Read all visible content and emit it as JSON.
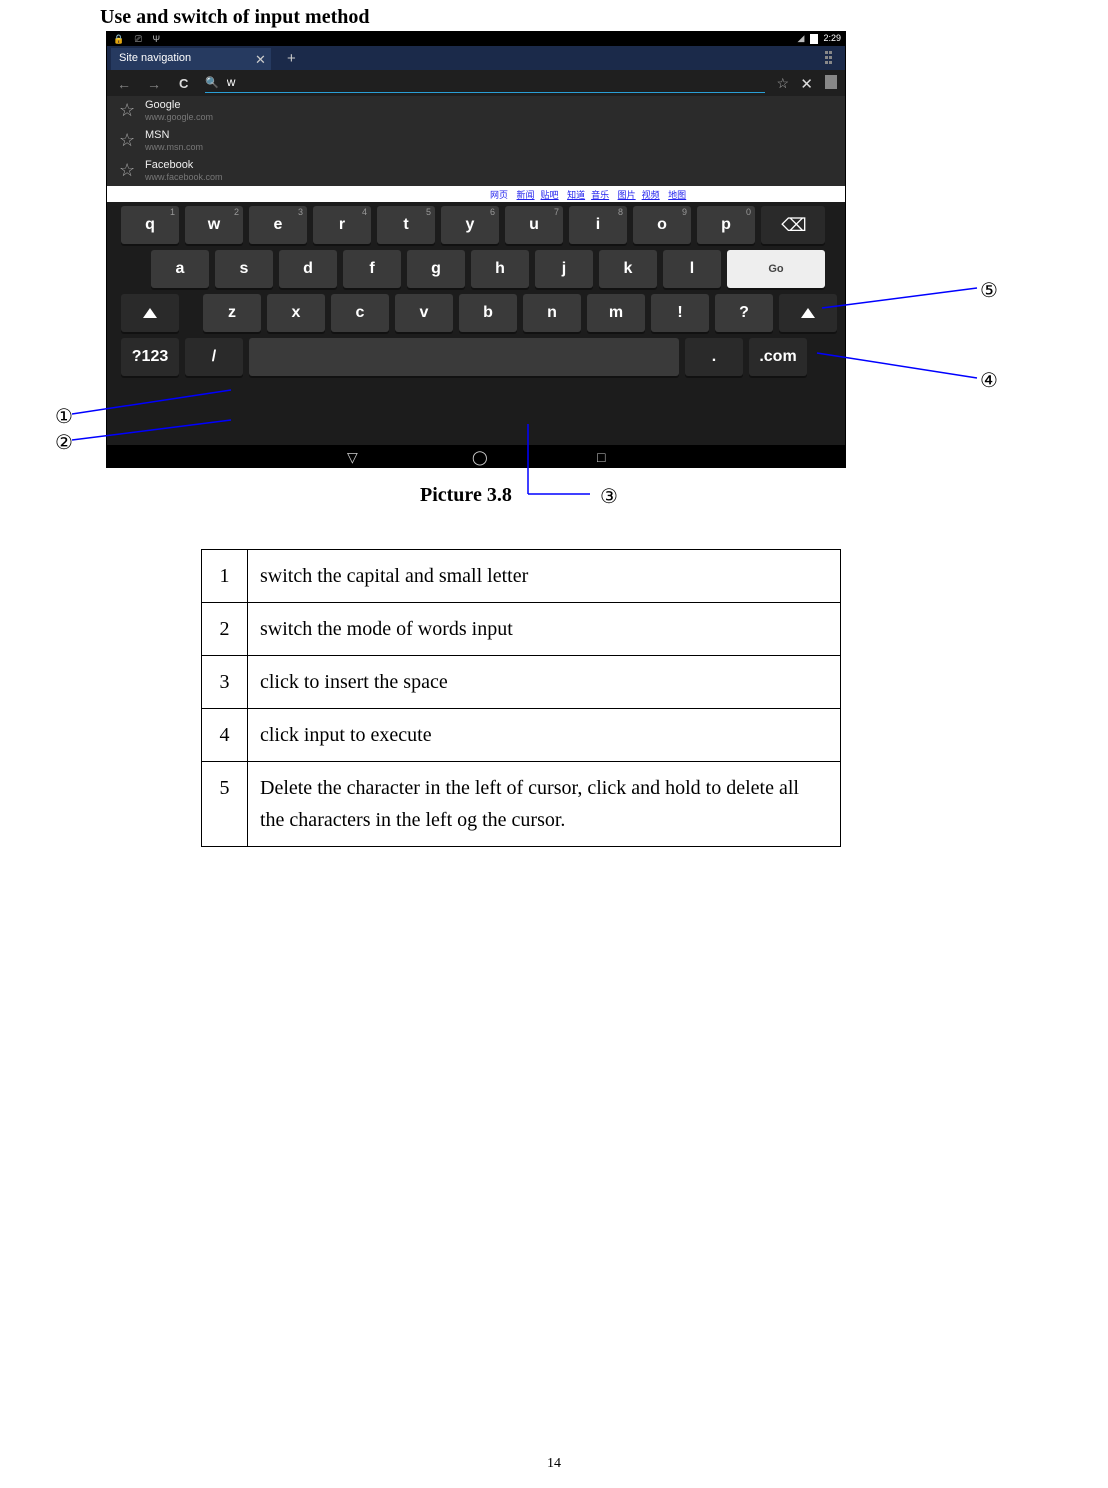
{
  "title": "Use and switch of input method",
  "caption": "Picture 3.8",
  "pagenum": "14",
  "status": {
    "time": "2:29"
  },
  "tab": {
    "label": "Site navigation"
  },
  "url": {
    "value": "w"
  },
  "sugg": [
    {
      "name": "Google",
      "url": "www.google.com"
    },
    {
      "name": "MSN",
      "url": "www.msn.com"
    },
    {
      "name": "Facebook",
      "url": "www.facebook.com"
    }
  ],
  "toplinks": [
    "网页",
    "新闻",
    "贴吧",
    "知道",
    "音乐",
    "图片",
    "视频",
    "地图"
  ],
  "kbd": {
    "row1": [
      {
        "k": "q",
        "s": "1"
      },
      {
        "k": "w",
        "s": "2"
      },
      {
        "k": "e",
        "s": "3"
      },
      {
        "k": "r",
        "s": "4"
      },
      {
        "k": "t",
        "s": "5"
      },
      {
        "k": "y",
        "s": "6"
      },
      {
        "k": "u",
        "s": "7"
      },
      {
        "k": "i",
        "s": "8"
      },
      {
        "k": "o",
        "s": "9"
      },
      {
        "k": "p",
        "s": "0"
      }
    ],
    "row2": [
      "a",
      "s",
      "d",
      "f",
      "g",
      "h",
      "j",
      "k",
      "l"
    ],
    "row3": [
      "z",
      "x",
      "c",
      "v",
      "b",
      "n",
      "m",
      "!",
      "?"
    ],
    "mode": "?123",
    "slash": "/",
    "dot": ".",
    "com": ".com",
    "go": "Go"
  },
  "ann": {
    "a1": "①",
    "a2": "②",
    "a3": "③",
    "a4": "④",
    "a5": "⑤"
  },
  "legend": [
    {
      "n": "1",
      "t": "switch the capital and small letter"
    },
    {
      "n": "2",
      "t": "switch the mode of words input"
    },
    {
      "n": "3",
      "t": "click to insert the space"
    },
    {
      "n": "4",
      "t": "click input to execute"
    },
    {
      "n": "5",
      "t": "Delete the character in the left of cursor, click and hold to delete all the characters in the left og the cursor."
    }
  ]
}
